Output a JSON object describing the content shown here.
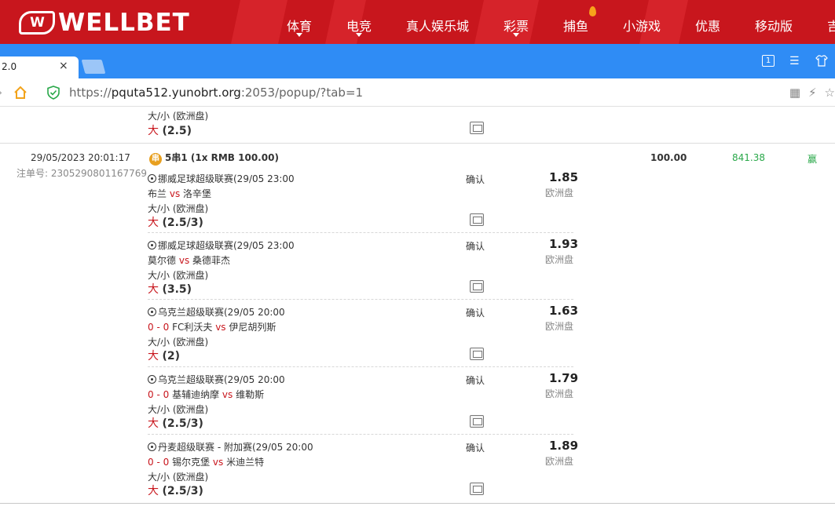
{
  "site": {
    "logo_badge": "W",
    "logo_text": "WELLBET",
    "nav": [
      {
        "label": "体育",
        "caret": true
      },
      {
        "label": "电竞",
        "caret": true
      },
      {
        "label": "真人娱乐城",
        "caret": false
      },
      {
        "label": "彩票",
        "caret": true
      },
      {
        "label": "捕鱼",
        "caret": false
      },
      {
        "label": "小游戏",
        "caret": false
      },
      {
        "label": "优惠",
        "caret": false
      },
      {
        "label": "移动版",
        "caret": false
      },
      {
        "label": "吉",
        "caret": false
      }
    ]
  },
  "browser": {
    "tab_title": "2.0",
    "tab_close": "×",
    "url_scheme": "https://",
    "url_host": "pquta512.yunobrt.org",
    "url_rest": ":2053/popup/?tab=1",
    "window_box_label": "1"
  },
  "prev_bet": {
    "market": "大/小 (欧洲盘)",
    "pick_side": "大",
    "pick_line": "(2.5)"
  },
  "bet": {
    "date": "29/05/2023 20:01:17",
    "order_label": "注单号: 2305290801167769",
    "badge": "串",
    "type": "5串1 (1x RMB 100.00)",
    "stake": "100.00",
    "payout": "841.38",
    "result": "赢",
    "legs": [
      {
        "league": "挪威足球超级联赛(29/05 23:00",
        "score": "",
        "home": "布兰",
        "vs": "vs",
        "away": "洛辛堡",
        "status": "确认",
        "odds": "1.85",
        "odds_type": "欧洲盘",
        "market": "大/小 (欧洲盘)",
        "pick_side": "大",
        "pick_line": "(2.5/3)"
      },
      {
        "league": "挪威足球超级联赛(29/05 23:00",
        "score": "",
        "home": "莫尔德",
        "vs": "vs",
        "away": "桑德菲杰",
        "status": "确认",
        "odds": "1.93",
        "odds_type": "欧洲盘",
        "market": "大/小 (欧洲盘)",
        "pick_side": "大",
        "pick_line": "(3.5)"
      },
      {
        "league": "乌克兰超级联赛(29/05 20:00",
        "score": "0 - 0",
        "home": "FC利沃夫",
        "vs": "vs",
        "away": "伊尼胡列斯",
        "status": "确认",
        "odds": "1.63",
        "odds_type": "欧洲盘",
        "market": "大/小 (欧洲盘)",
        "pick_side": "大",
        "pick_line": "(2)"
      },
      {
        "league": "乌克兰超级联赛(29/05 20:00",
        "score": "0 - 0",
        "home": "基辅迪纳摩",
        "vs": "vs",
        "away": "维勒斯",
        "status": "确认",
        "odds": "1.79",
        "odds_type": "欧洲盘",
        "market": "大/小 (欧洲盘)",
        "pick_side": "大",
        "pick_line": "(2.5/3)"
      },
      {
        "league": "丹麦超级联赛 - 附加赛(29/05 20:00",
        "score": "0 - 0",
        "home": "锡尔克堡",
        "vs": "vs",
        "away": "米迪兰特",
        "status": "确认",
        "odds": "1.89",
        "odds_type": "欧洲盘",
        "market": "大/小 (欧洲盘)",
        "pick_side": "大",
        "pick_line": "(2.5/3)"
      }
    ]
  },
  "colors": {
    "brand_red": "#c8161d",
    "browser_blue": "#2f8cf5",
    "win_green": "#2aa84a"
  }
}
